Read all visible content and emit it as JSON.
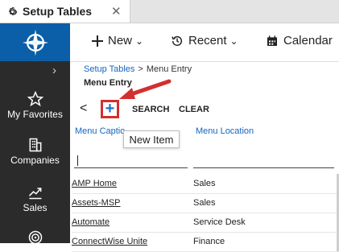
{
  "tab": {
    "title": "Setup Tables",
    "close": "✕"
  },
  "sidebar": {
    "collapse_glyph": "›",
    "items": [
      {
        "label": "My Favorites",
        "icon": "star-icon"
      },
      {
        "label": "Companies",
        "icon": "building-icon"
      },
      {
        "label": "Sales",
        "icon": "chart-icon"
      },
      {
        "label": "",
        "icon": "target-icon"
      }
    ]
  },
  "topbar": {
    "new_label": "New",
    "recent_label": "Recent",
    "calendar_label": "Calendar"
  },
  "breadcrumb": {
    "parent": "Setup Tables",
    "separator": ">",
    "current": "Menu Entry"
  },
  "page_title": "Menu Entry",
  "actions": {
    "back": "<",
    "add": "+",
    "search": "SEARCH",
    "clear": "CLEAR"
  },
  "tooltip": "New Item",
  "grid": {
    "columns": [
      "Menu Captio",
      "Menu Location"
    ],
    "rows": [
      {
        "caption": "AMP Home",
        "location": "Sales"
      },
      {
        "caption": "Assets-MSP",
        "location": "Sales"
      },
      {
        "caption": "Automate",
        "location": "Service Desk"
      },
      {
        "caption": "ConnectWise Unite",
        "location": "Finance"
      }
    ]
  },
  "colors": {
    "accent": "#0a5fa8",
    "sidebar": "#2b2b2b",
    "highlight": "#d32f2f",
    "link": "#1565c0"
  }
}
